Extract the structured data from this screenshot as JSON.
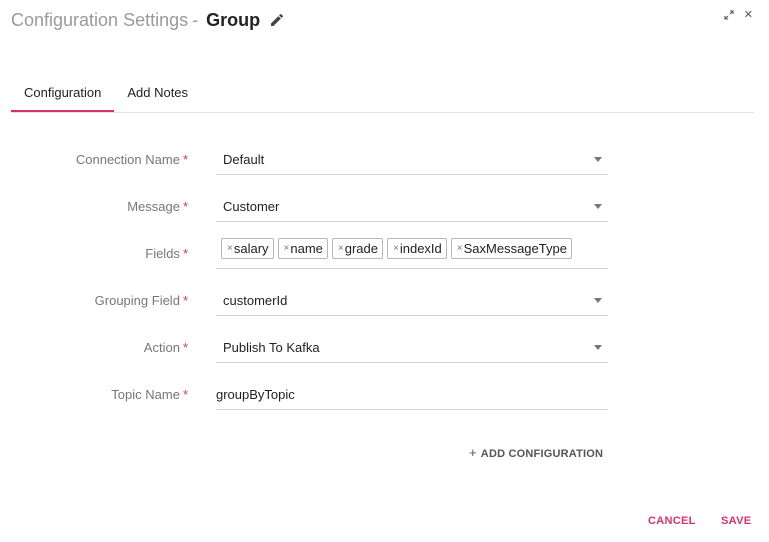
{
  "header": {
    "title": "Configuration Settings",
    "separator": "-",
    "name": "Group",
    "edit_icon": "pencil-icon",
    "expand_icon": "expand-icon",
    "close_glyph": "✕"
  },
  "tabs": [
    {
      "label": "Configuration",
      "active": true
    },
    {
      "label": "Add Notes",
      "active": false
    }
  ],
  "form": {
    "required_marker": "*",
    "connection_name": {
      "label": "Connection Name",
      "value": "Default"
    },
    "message": {
      "label": "Message",
      "value": "Customer"
    },
    "fields": {
      "label": "Fields",
      "tags": [
        "salary",
        "name",
        "grade",
        "indexId",
        "SaxMessageType"
      ],
      "remove_glyph": "×"
    },
    "grouping_field": {
      "label": "Grouping Field",
      "value": "customerId"
    },
    "action": {
      "label": "Action",
      "value": "Publish To Kafka"
    },
    "topic_name": {
      "label": "Topic Name",
      "value": "groupByTopic"
    }
  },
  "add_configuration": {
    "plus": "+",
    "label": "ADD CONFIGURATION"
  },
  "footer": {
    "cancel_label": "CANCEL",
    "save_label": "SAVE"
  },
  "colors": {
    "accent": "#d6336c",
    "label": "#777777",
    "text": "#222222"
  }
}
